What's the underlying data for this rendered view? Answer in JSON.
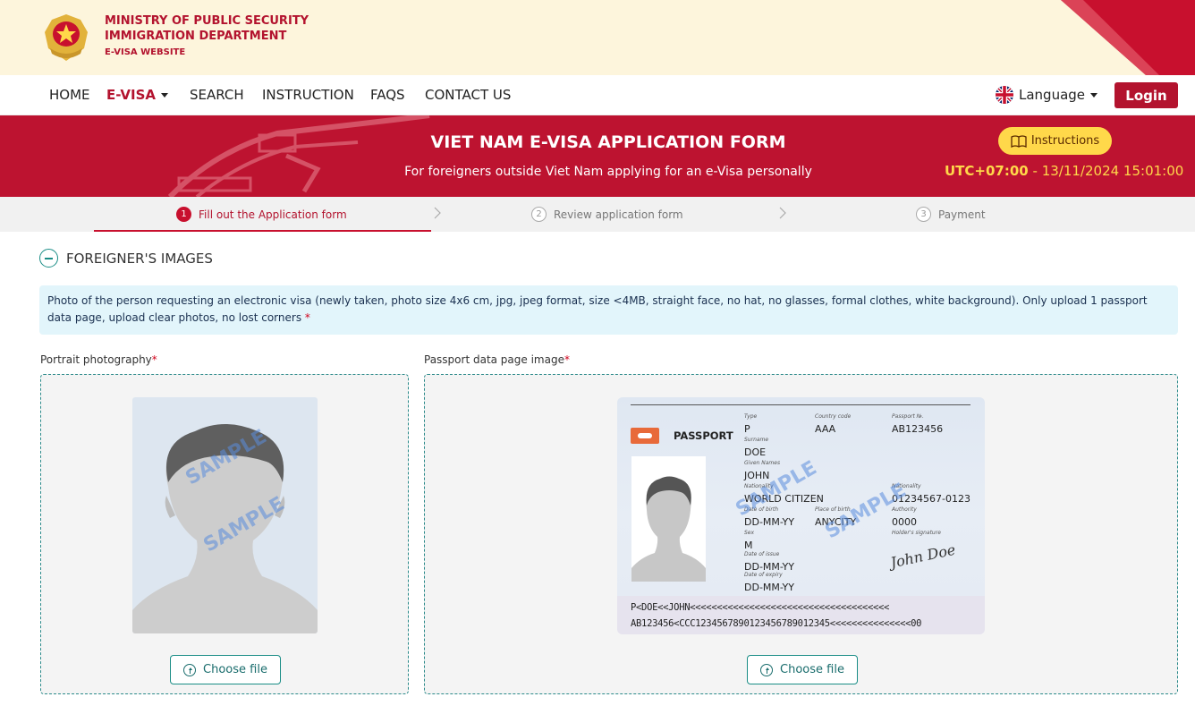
{
  "header": {
    "org_line1": "MINISTRY OF PUBLIC SECURITY",
    "org_line2": "IMMIGRATION DEPARTMENT",
    "org_line3": "E-VISA WEBSITE"
  },
  "nav": {
    "items": [
      "HOME",
      "E-VISA",
      "SEARCH",
      "INSTRUCTION",
      "FAQS",
      "CONTACT US"
    ],
    "language": "Language",
    "login": "Login"
  },
  "banner": {
    "title": "VIET NAM E-VISA APPLICATION FORM",
    "subtitle": "For foreigners outside Viet Nam applying for an e-Visa personally",
    "instructions": "Instructions",
    "timezone": "UTC+07:00",
    "datetime": " - 13/11/2024 15:01:00"
  },
  "steps": [
    {
      "num": "1",
      "label": "Fill out the Application form"
    },
    {
      "num": "2",
      "label": "Review application form"
    },
    {
      "num": "3",
      "label": "Payment"
    }
  ],
  "section": {
    "title": "FOREIGNER'S IMAGES",
    "notice": "Photo of the person requesting an electronic visa (newly taken, photo size 4x6 cm, jpg, jpeg format, size <4MB, straight face, no hat, no glasses, formal clothes, white background). Only upload 1 passport data page, upload clear photos, no lost corners",
    "required_mark": "*"
  },
  "portrait": {
    "label": "Portrait photography",
    "watermark": "SAMPLE",
    "button": "Choose file"
  },
  "passport": {
    "label": "Passport data page image",
    "button": "Choose file",
    "heading": "PASSPORT",
    "watermark": "SAMPLE",
    "fields": {
      "type_label": "Type",
      "type": "P",
      "country_label": "Country code",
      "country": "AAA",
      "number_label": "Passport №.",
      "number": "AB123456",
      "surname_label": "Surname",
      "surname": "DOE",
      "given_label": "Given Names",
      "given": "JOHN",
      "nationality_label": "Nationality",
      "nationality": "WORLD CITIZEN",
      "personal_label": "Nationality",
      "personal": "01234567-0123",
      "dob_label": "Date of birth",
      "dob": "DD-MM-YY",
      "pob_label": "Place of birth",
      "pob": "ANYCITY",
      "authority_label": "Authority",
      "authority": "0000",
      "sex_label": "Sex",
      "sex": "M",
      "signature_label": "Holder's signature",
      "issue_label": "Date of issue",
      "issue": "DD-MM-YY",
      "expiry_label": "Date of expiry",
      "expiry": "DD-MM-YY"
    },
    "mrz1": "P<DOE<<JOHN<<<<<<<<<<<<<<<<<<<<<<<<<<<<<<<<<<<<<",
    "mrz2": "AB123456<CCC1234567890123456789012345<<<<<<<<<<<<<<<00",
    "signature": "John Doe"
  },
  "colors": {
    "brand_red": "#b3132e",
    "accent_yellow": "#ffd84a",
    "teal": "#1a8d86"
  }
}
